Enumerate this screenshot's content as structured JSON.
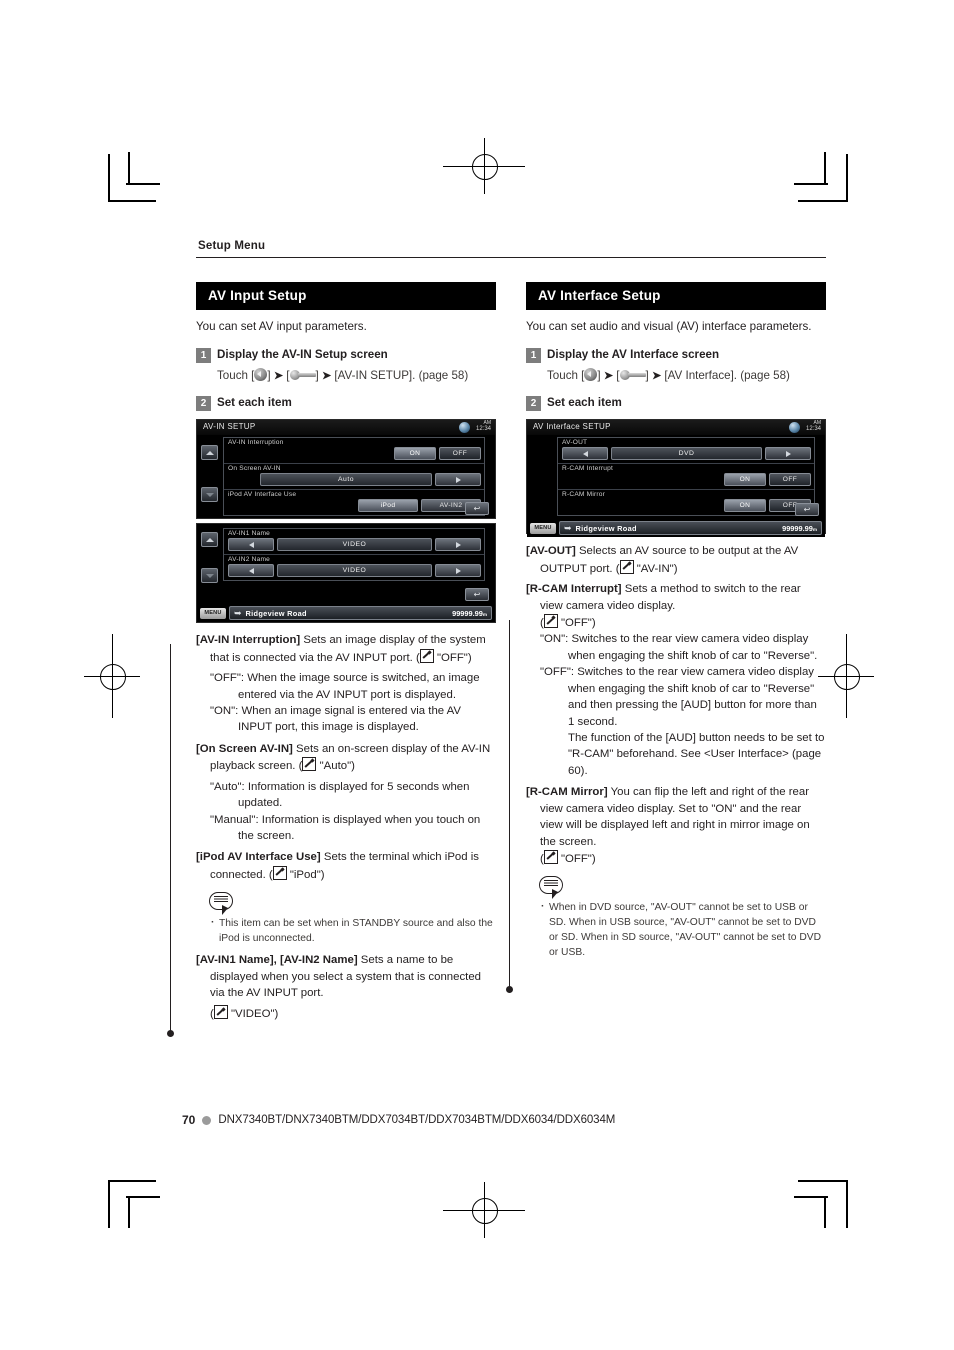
{
  "running_head": "Setup Menu",
  "footer": {
    "page_number": "70",
    "models": "DNX7340BT/DNX7340BTM/DDX7034BT/DDX7034BTM/DDX6034/DDX6034M"
  },
  "left_column": {
    "section_title": "AV Input Setup",
    "intro": "You can set AV input parameters.",
    "steps": [
      {
        "num": "1",
        "title": "Display the AV-IN Setup screen",
        "touch_prefix": "Touch [",
        "touch_mid": "] ",
        "touch_arrow": "➤",
        "touch_suffix": "[AV-IN SETUP]. (page 58)"
      },
      {
        "num": "2",
        "title": "Set each item"
      }
    ],
    "screenshot_1": {
      "title": "AV-IN SETUP",
      "clock_ampm": "AM",
      "clock_time": "12:34",
      "rows": [
        {
          "label": "AV-IN Interruption",
          "type": "onoff",
          "on": "ON",
          "off": "OFF",
          "selected": "ON"
        },
        {
          "label": "On Screen AV-IN",
          "type": "field",
          "value": "Auto"
        },
        {
          "label": "iPod AV Interface Use",
          "type": "pair",
          "left": "iPod",
          "right": "AV-IN2",
          "selected": "iPod"
        }
      ]
    },
    "screenshot_2": {
      "rows": [
        {
          "label": "AV-IN1 Name",
          "value": "VIDEO"
        },
        {
          "label": "AV-IN2 Name",
          "value": "VIDEO"
        }
      ],
      "nav": {
        "menu": "MENU",
        "street": "Ridgeview Road",
        "distance": "99999.99",
        "unit": "m"
      }
    },
    "definitions": [
      {
        "label": "[AV-IN Interruption]",
        "text": "Sets an image display of the system that is connected via the AV INPUT port. (",
        "default": "\"OFF\")",
        "sub": [
          {
            "key": "\"OFF\":",
            "val": "When the image source is switched, an image entered via the AV INPUT port is displayed."
          },
          {
            "key": "\"ON\":",
            "val": "When an image signal is entered via the AV INPUT port, this image is displayed."
          }
        ]
      },
      {
        "label": "[On Screen AV-IN]",
        "text": "Sets an on-screen display of the AV-IN playback screen. (",
        "default": "\"Auto\")",
        "sub": [
          {
            "key": "\"Auto\":",
            "val": "Information is displayed for 5 seconds when updated."
          },
          {
            "key": "\"Manual\":",
            "val": "Information is displayed when you touch on the screen."
          }
        ]
      },
      {
        "label": "[iPod AV Interface Use]",
        "text": "Sets the terminal which iPod is connected. (",
        "default": "\"iPod\")",
        "sub": []
      }
    ],
    "note": {
      "items": [
        "This item can be set when in STANDBY source and also the iPod is unconnected."
      ]
    },
    "definitions_after_note": [
      {
        "label": "[AV-IN1 Name], [AV-IN2 Name]",
        "text": "Sets a name to be displayed when you select a system that is connected via the AV INPUT port.",
        "default_prefix": "(",
        "default": "\"VIDEO\")",
        "sub": []
      }
    ]
  },
  "right_column": {
    "section_title": "AV Interface Setup",
    "intro": "You can set audio and visual (AV) interface parameters.",
    "steps": [
      {
        "num": "1",
        "title": "Display the AV Interface screen",
        "touch_prefix": "Touch [",
        "touch_suffix": "[AV Interface]. (page 58)"
      },
      {
        "num": "2",
        "title": "Set each item"
      }
    ],
    "screenshot": {
      "title": "AV Interface SETUP",
      "clock_ampm": "AM",
      "clock_time": "12:34",
      "rows": [
        {
          "label": "AV-OUT",
          "type": "field",
          "value": "DVD"
        },
        {
          "label": "R-CAM Interrupt",
          "type": "onoff",
          "on": "ON",
          "off": "OFF",
          "selected": "ON"
        },
        {
          "label": "R-CAM Mirror",
          "type": "onoff",
          "on": "ON",
          "off": "OFF",
          "selected": "ON"
        }
      ],
      "nav": {
        "menu": "MENU",
        "street": "Ridgeview Road",
        "distance": "99999.99",
        "unit": "m"
      }
    },
    "definitions": [
      {
        "label": "[AV-OUT]",
        "text": "Selects an AV source to be output at the AV OUTPUT port. (",
        "default": "\"AV-IN\")",
        "sub": []
      },
      {
        "label": "[R-CAM Interrupt]",
        "text": "Sets a method to switch to the rear view camera video display.",
        "default_prefix": "(",
        "default": "\"OFF\")",
        "sub": [
          {
            "key": "\"ON\":",
            "val": "Switches to the rear view camera video display when engaging the shift knob of car to \"Reverse\"."
          },
          {
            "key": "\"OFF\":",
            "val": "Switches to the rear view camera video display when engaging the shift knob of car to \"Reverse\" and then pressing the [AUD] button for more than 1 second."
          },
          {
            "key": "",
            "val": "The function of the [AUD] button needs to be set to \"R-CAM\" beforehand.  See <User Interface> (page 60)."
          }
        ]
      },
      {
        "label": "[R-CAM Mirror]",
        "text": "You can flip the left and right of the rear view camera video display. Set to \"ON\" and the rear view will be displayed left and right in mirror image on the screen.",
        "default_prefix": "(",
        "default": "\"OFF\")",
        "sub": []
      }
    ],
    "note": {
      "items": [
        "When in DVD source, \"AV-OUT\" cannot be set to USB or SD. When in USB source, \"AV-OUT\" cannot be set to DVD or SD. When in SD source, \"AV-OUT\" cannot be set to DVD or USB."
      ]
    }
  }
}
